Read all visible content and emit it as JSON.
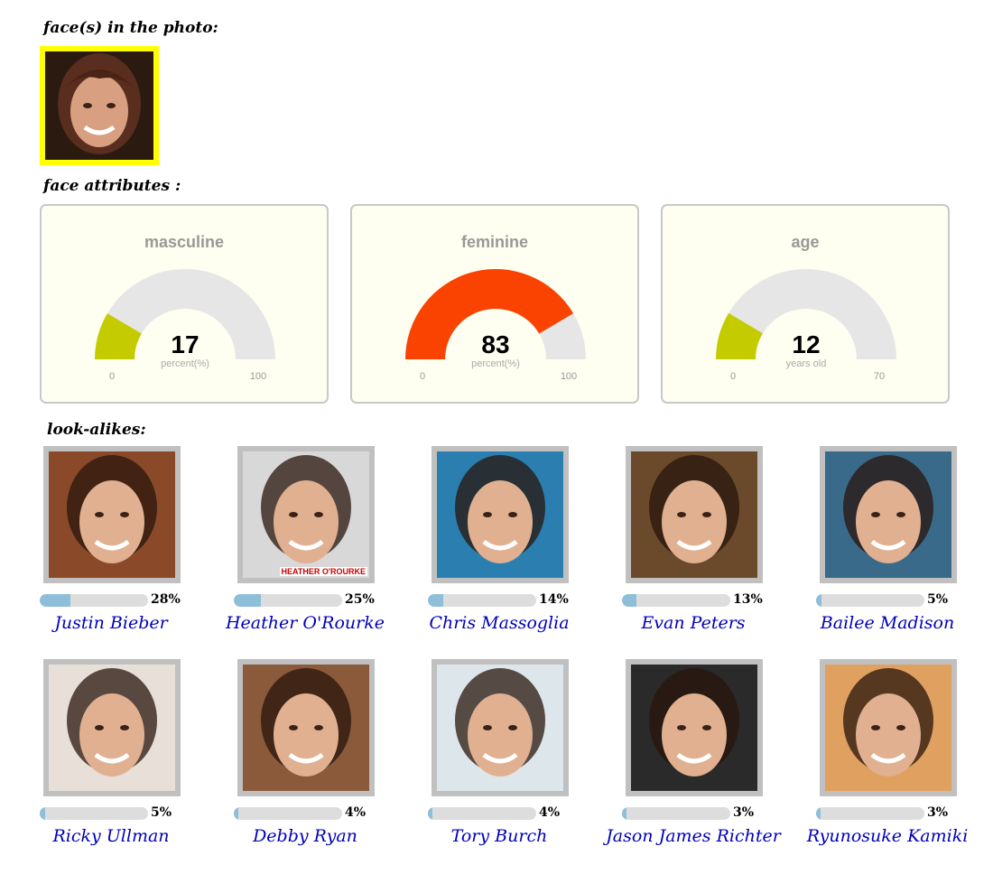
{
  "headings": {
    "faces": "face(s) in the photo:",
    "attributes": "face attributes :",
    "lookalikes": "look-alikes:"
  },
  "gauges": [
    {
      "title": "masculine",
      "value": 17,
      "unit": "percent(%)",
      "min": 0,
      "max": 100,
      "min_label": "0",
      "max_label": "100",
      "color": "#c4cc00"
    },
    {
      "title": "feminine",
      "value": 83,
      "unit": "percent(%)",
      "min": 0,
      "max": 100,
      "min_label": "0",
      "max_label": "100",
      "color": "#fa4300"
    },
    {
      "title": "age",
      "value": 12,
      "unit": "years old",
      "min": 0,
      "max": 70,
      "min_label": "0",
      "max_label": "70",
      "color": "#c4cc00"
    }
  ],
  "lookalikes": [
    {
      "name": "Justin Bieber",
      "pct": 28,
      "pct_label": "28%",
      "bg": "#8a4a2a"
    },
    {
      "name": "Heather O'Rourke",
      "pct": 25,
      "pct_label": "25%",
      "bg": "#d8d8d8",
      "caption": "HEATHER O'ROURKE"
    },
    {
      "name": "Chris Massoglia",
      "pct": 14,
      "pct_label": "14%",
      "bg": "#2a7fb0"
    },
    {
      "name": "Evan Peters",
      "pct": 13,
      "pct_label": "13%",
      "bg": "#6a4a2a"
    },
    {
      "name": "Bailee Madison",
      "pct": 5,
      "pct_label": "5%",
      "bg": "#3a6a8a"
    },
    {
      "name": "Ricky Ullman",
      "pct": 5,
      "pct_label": "5%",
      "bg": "#e8e0d8"
    },
    {
      "name": "Debby Ryan",
      "pct": 4,
      "pct_label": "4%",
      "bg": "#8a5a3a"
    },
    {
      "name": "Tory Burch",
      "pct": 4,
      "pct_label": "4%",
      "bg": "#dde6ea"
    },
    {
      "name": "Jason James Richter",
      "pct": 3,
      "pct_label": "3%",
      "bg": "#2a2a2a"
    },
    {
      "name": "Ryunosuke Kamiki",
      "pct": 3,
      "pct_label": "3%",
      "bg": "#e0a060"
    }
  ]
}
